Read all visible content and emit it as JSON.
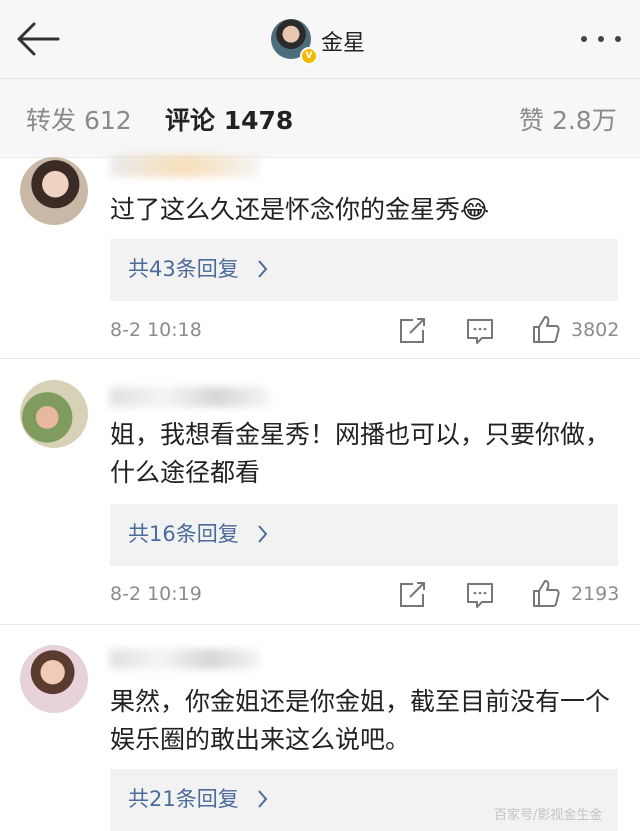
{
  "header": {
    "title": "金星"
  },
  "tabs": [
    {
      "label": "转发 612"
    },
    {
      "label": "评论 1478"
    },
    {
      "label": "赞 2.8万"
    }
  ],
  "comments": [
    {
      "text": "过了这么久还是怀念你的金星秀😂",
      "replies": "共43条回复",
      "time": "8-2 10:18",
      "likes": "3802"
    },
    {
      "text": "姐，我想看金星秀！网播也可以，只要你做，什么途径都看",
      "replies": "共16条回复",
      "time": "8-2 10:19",
      "likes": "2193"
    },
    {
      "text": "果然，你金姐还是你金姐，截至目前没有一个娱乐圈的敢出来这么说吧。",
      "replies": "共21条回复"
    }
  ],
  "watermark": "百家号/影视金生金"
}
